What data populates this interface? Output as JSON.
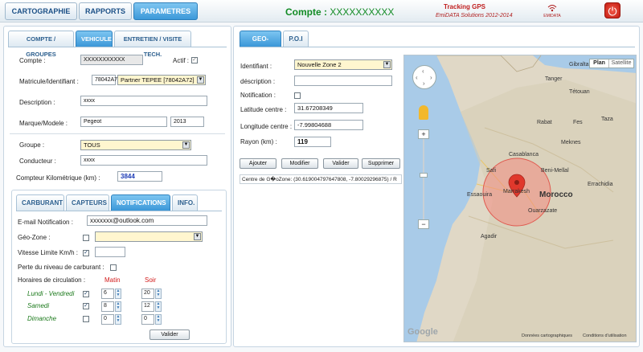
{
  "nav": {
    "cartographie": "CARTOGRAPHIE",
    "rapports": "RAPPORTS",
    "parametres": "PARAMETRES"
  },
  "header": {
    "compte_label": "Compte :",
    "compte_value": "XXXXXXXXXX",
    "tracking": "Tracking GPS",
    "solutions": "EmiDATA Solutions 2012-2014",
    "logo": "EMIDATA"
  },
  "left_tabs": [
    "COMPTE / GROUPES",
    "VEHICULE",
    "ENTRETIEN / VISITE TECH."
  ],
  "vehicle": {
    "compte_label": "Compte :",
    "compte_value": "XXXXXXXXXXX",
    "actif_label": "Actif :",
    "matricule_label": "Matricule/Identifiant :",
    "matricule_value": "78042A72",
    "partner_value": "Partner TEPEE [78042A72]",
    "description_label": "Description :",
    "description_value": "xxxx",
    "marque_label": "Marque/Modele :",
    "marque_value": "Pegeot",
    "annee_value": "2013",
    "groupe_label": "Groupe :",
    "groupe_value": "TOUS",
    "conducteur_label": "Conducteur :",
    "conducteur_value": "xxxx",
    "compteur_label": "Compteur Kilométrique (km) :",
    "compteur_value": "3844"
  },
  "sub_tabs": [
    "CARBURANT",
    "CAPTEURS",
    "NOTIFICATIONS",
    "INFO."
  ],
  "notifications": {
    "email_label": "E-mail Notification :",
    "email_value": "xxxxxxx@outlook.com",
    "geozone_label": "Géo-Zone :",
    "vitesse_label": "Vitesse Limite Km/h :",
    "carburant_label": "Perte du niveau de carburant :",
    "horaires_label": "Horaires de circulation :",
    "matin_label": "Matin",
    "soir_label": "Soir",
    "rows": [
      {
        "label": "Lundi - Vendredi",
        "checked": true,
        "matin": "6",
        "soir": "20"
      },
      {
        "label": "Samedi",
        "checked": true,
        "matin": "8",
        "soir": "12"
      },
      {
        "label": "Dimanche",
        "checked": false,
        "matin": "0",
        "soir": "0"
      }
    ],
    "valider": "Valider"
  },
  "right_tabs": [
    "GEO-ZONE",
    "P.O.I"
  ],
  "geozone": {
    "identifiant_label": "Identifiant :",
    "identifiant_value": "Nouvelle Zone 2",
    "description_label": "déscription :",
    "notification_label": "Notification :",
    "latitude_label": "Latitude centre :",
    "latitude_value": "31.67208349",
    "longitude_label": "Longitude centre :",
    "longitude_value": "-7.99804688",
    "rayon_label": "Rayon (km) :",
    "rayon_value": "119",
    "buttons": [
      "Ajouter",
      "Modifier",
      "Valider",
      "Supprimer"
    ],
    "centre_text": "Centre de G�oZone: (30.619004797647808, -7.80029296875) / R"
  },
  "map": {
    "plan": "Plan",
    "satellite": "Satellite",
    "donnees": "Données cartographiques",
    "conditions": "Conditions d'utilisation",
    "google": "Google",
    "cities": [
      {
        "name": "Tanger"
      },
      {
        "name": "Tétouan"
      },
      {
        "name": "Rabat"
      },
      {
        "name": "Fes"
      },
      {
        "name": "Meknes"
      },
      {
        "name": "Casablanca"
      },
      {
        "name": "Taza"
      },
      {
        "name": "Beni-Mellal"
      },
      {
        "name": "Safi"
      },
      {
        "name": "Errachidia"
      },
      {
        "name": "Essaouira"
      },
      {
        "name": "Marrakesh"
      },
      {
        "name": "Morocco"
      },
      {
        "name": "Ouarzazate"
      },
      {
        "name": "Agadir"
      },
      {
        "name": "Gibraltar"
      }
    ]
  }
}
